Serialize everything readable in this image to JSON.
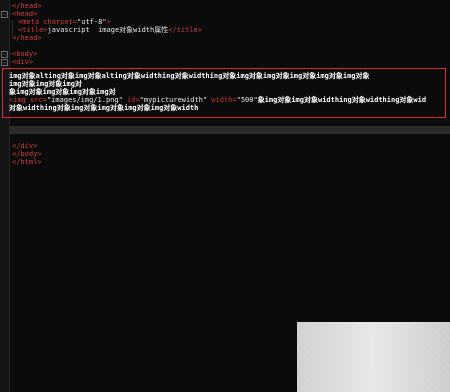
{
  "editor": {
    "lines": {
      "l1": "</head>",
      "l2": "<head>",
      "l3_tag": "<meta charset=",
      "l3_val": "\"utf-8\"",
      "l3_end": ">",
      "l4_open": "<title>",
      "l4_text": "javascript  image对象width属性",
      "l4_close": "</title>",
      "l5": "</head>",
      "l6": "<body>",
      "l7": "<div>",
      "c1": "img对象alting对象img对象alting对象widthing对象widthing对象img对象img对象img对象img对象img对象",
      "c2": "img对象img对象img对",
      "c3": "象img对象img对象img对象img对",
      "c4_tag": "<img src=",
      "c4_src": "\"images/img/1.png\"",
      "c4_id_attr": " id=",
      "c4_id_val": "\"mypicturewidth\"",
      "c4_w_attr": " width=",
      "c4_w_val": "\"500\"",
      "c4_tail": "象img对象img对象widthing对象widthing对象wid",
      "c5": "对象widthing对象img对象img对象img对象img对象width",
      "l8": "</div>",
      "l9": "</body>",
      "l10": "</html>"
    }
  }
}
